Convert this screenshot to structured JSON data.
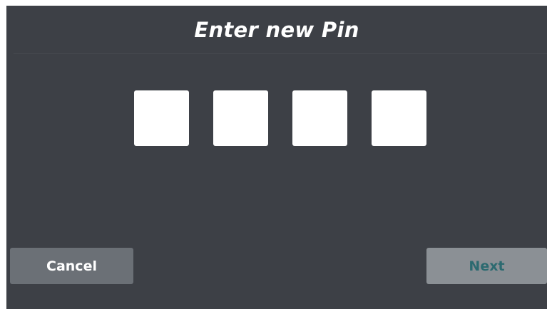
{
  "dialog": {
    "title": "Enter new Pin",
    "pin": {
      "digit_count": 4,
      "values": [
        "",
        "",
        "",
        ""
      ]
    }
  },
  "buttons": {
    "cancel_label": "Cancel",
    "next_label": "Next"
  },
  "colors": {
    "background": "#3d4046",
    "pin_box": "#ffffff",
    "cancel_button": "#6b7076",
    "next_button": "#8b9095",
    "next_text": "#2c6a70"
  }
}
